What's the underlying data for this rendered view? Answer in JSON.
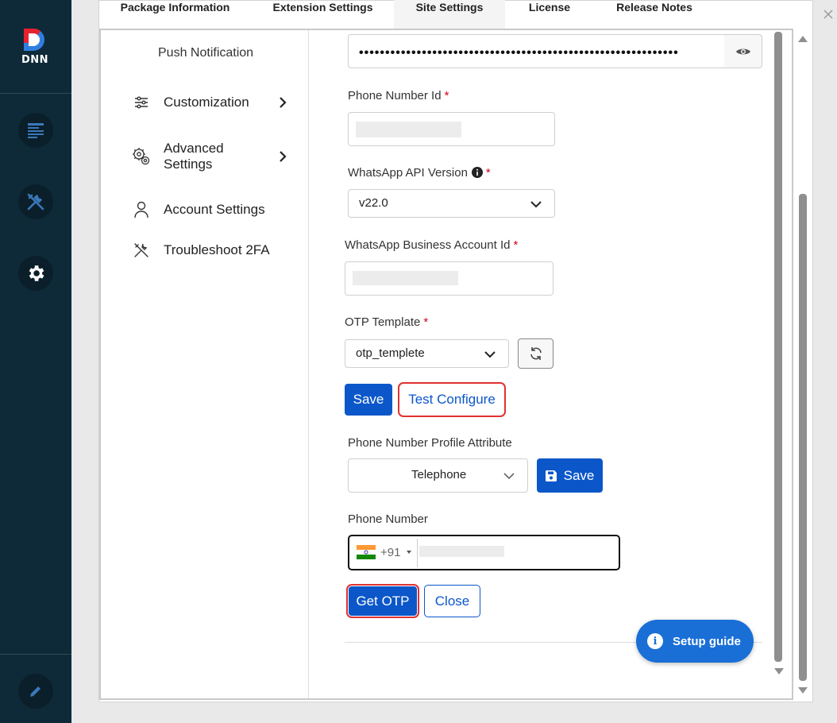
{
  "app": {
    "logo_text": "DNN"
  },
  "tabs": [
    {
      "label": "Package Information"
    },
    {
      "label": "Extension Settings"
    },
    {
      "label": "Site Settings"
    },
    {
      "label": "License"
    },
    {
      "label": "Release Notes"
    }
  ],
  "sidebar": {
    "title": "Push Notification",
    "items": [
      {
        "label": "Customization"
      },
      {
        "label": "Advanced Settings"
      },
      {
        "label": "Account Settings"
      },
      {
        "label": "Troubleshoot 2FA"
      }
    ]
  },
  "form": {
    "token_mask": "•••••••••••••••••••••••••••••••••••••••••••••••••••••••••••••",
    "phone_number_id_label": "Phone Number Id",
    "api_version_label": "WhatsApp API Version",
    "api_version_value": "v22.0",
    "business_account_label": "WhatsApp Business Account Id",
    "otp_template_label": "OTP Template",
    "otp_template_value": "otp_templete",
    "save_label": "Save",
    "test_configure_label": "Test Configure",
    "profile_attr_label": "Phone Number Profile Attribute",
    "profile_attr_value": "Telephone",
    "profile_save_label": "Save",
    "phone_number_label": "Phone Number",
    "dial_code": "+91",
    "get_otp_label": "Get OTP",
    "close_label": "Close",
    "required_mark": "*"
  },
  "setup_guide": {
    "label": "Setup guide",
    "icon_glyph": "i"
  },
  "colors": {
    "primary": "#0b57c9",
    "rail": "#0e2a38",
    "required": "#d0021b",
    "highlight": "#e03131"
  }
}
